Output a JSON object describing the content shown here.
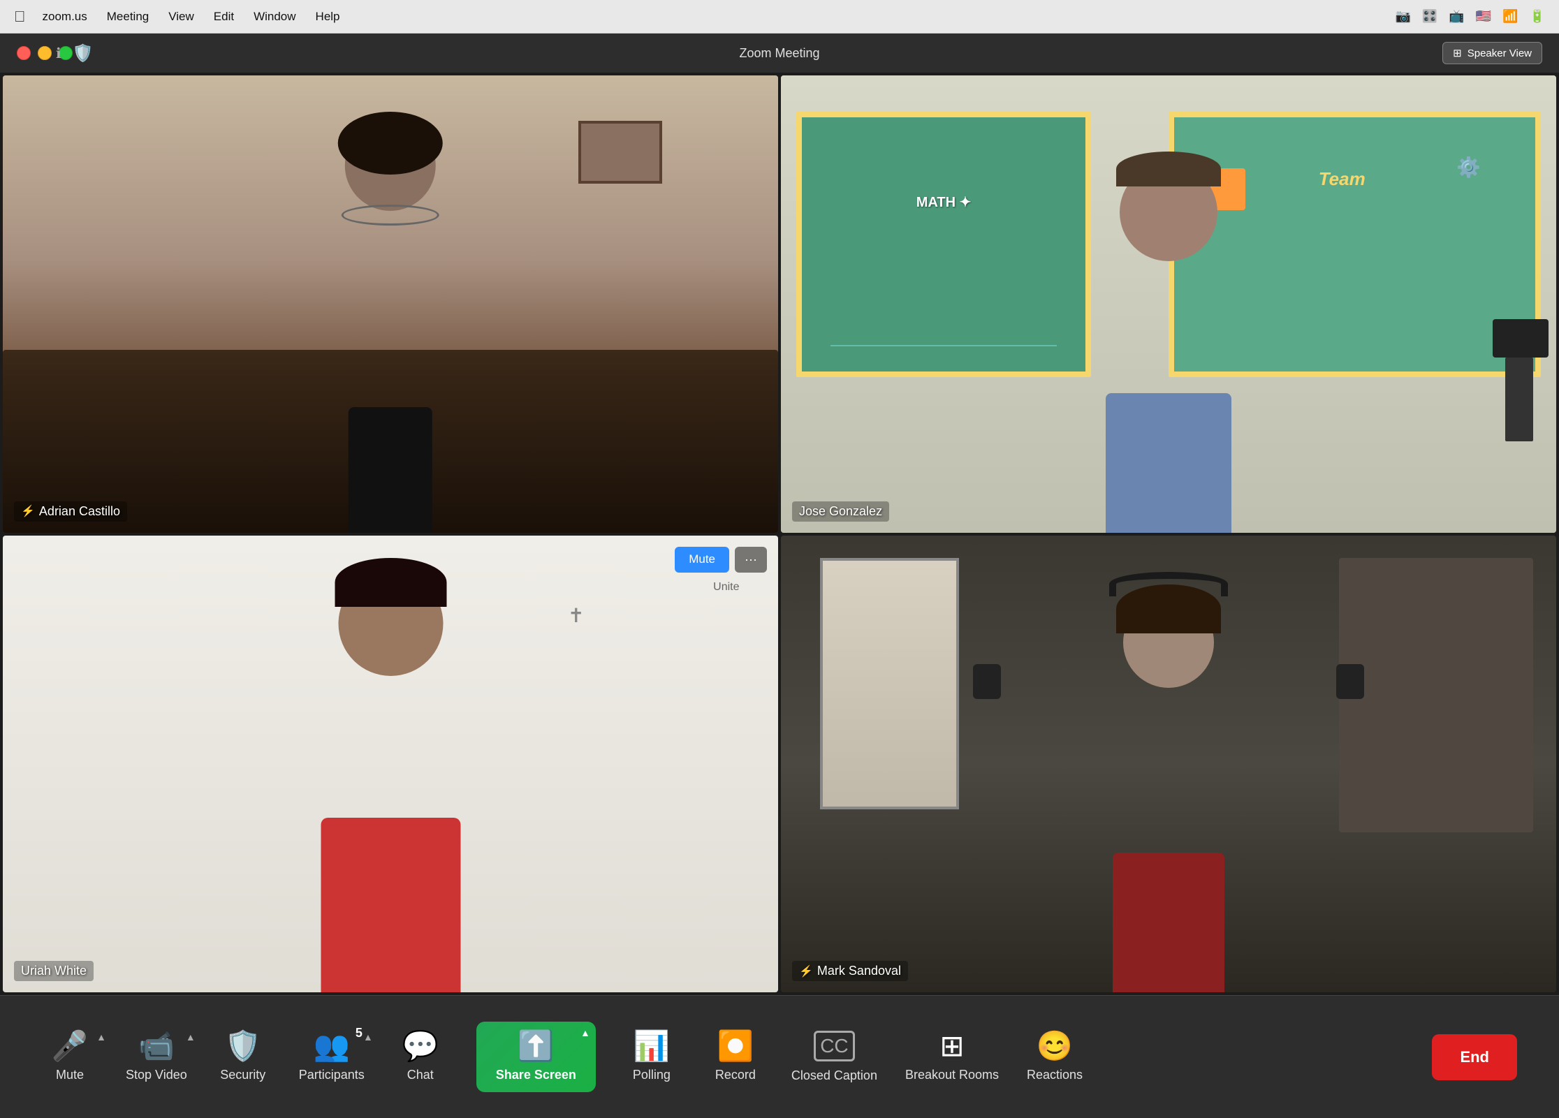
{
  "menubar": {
    "apple": "🍎",
    "app": "zoom.us",
    "items": [
      "Meeting",
      "View",
      "Edit",
      "Window",
      "Help"
    ],
    "sysicons": [
      "🎥",
      "🎛️",
      "📺",
      "🇺🇸",
      "📶",
      "🔋"
    ]
  },
  "titlebar": {
    "title": "Zoom Meeting",
    "speaker_view": "Speaker View",
    "traffic_lights": {
      "red": "close",
      "yellow": "minimize",
      "green": "maximize"
    }
  },
  "participants": [
    {
      "id": "p1",
      "name": "Adrian Castillo",
      "muted": true,
      "position": "top-left",
      "active_speaker": false
    },
    {
      "id": "p2",
      "name": "Jose Gonzalez",
      "muted": false,
      "position": "top-right",
      "active_speaker": true
    },
    {
      "id": "p3",
      "name": "Uriah White",
      "muted": false,
      "position": "bottom-left",
      "active_speaker": false
    },
    {
      "id": "p4",
      "name": "Mark Sandoval",
      "muted": true,
      "position": "bottom-right",
      "active_speaker": false
    }
  ],
  "cell_controls": {
    "mute_label": "Mute",
    "more_label": "···"
  },
  "toolbar": {
    "items": [
      {
        "id": "mute",
        "label": "Mute",
        "icon": "mic",
        "has_arrow": true
      },
      {
        "id": "stop-video",
        "label": "Stop Video",
        "icon": "video",
        "has_arrow": true
      },
      {
        "id": "security",
        "label": "Security",
        "icon": "shield",
        "has_arrow": false
      },
      {
        "id": "participants",
        "label": "Participants",
        "icon": "people",
        "has_arrow": true,
        "count": "5"
      },
      {
        "id": "chat",
        "label": "Chat",
        "icon": "chat",
        "has_arrow": false
      },
      {
        "id": "share-screen",
        "label": "Share Screen",
        "icon": "share",
        "has_arrow": true,
        "highlighted": true
      },
      {
        "id": "polling",
        "label": "Polling",
        "icon": "polling",
        "has_arrow": false
      },
      {
        "id": "record",
        "label": "Record",
        "icon": "record",
        "has_arrow": false
      },
      {
        "id": "closed-caption",
        "label": "Closed Caption",
        "icon": "cc",
        "has_arrow": false
      },
      {
        "id": "breakout-rooms",
        "label": "Breakout Rooms",
        "icon": "breakout",
        "has_arrow": false
      },
      {
        "id": "reactions",
        "label": "Reactions",
        "icon": "emoji",
        "has_arrow": false
      }
    ],
    "end_label": "End"
  },
  "colors": {
    "toolbar_bg": "#2d2d2d",
    "title_bg": "#2d2d2d",
    "active_speaker_border": "#f9c74f",
    "mute_btn": "#2d8cff",
    "end_btn": "#e02020",
    "share_screen_bg": "#22c55e"
  }
}
